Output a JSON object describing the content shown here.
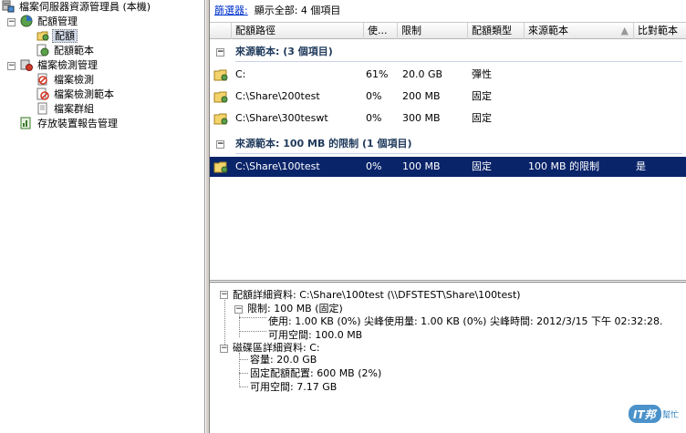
{
  "tree": {
    "root": "檔案伺服器資源管理員 (本機)",
    "quota_management": "配額管理",
    "quotas": "配額",
    "quota_templates": "配額範本",
    "file_screening": "檔案檢測管理",
    "file_screens": "檔案檢測",
    "file_screen_templates": "檔案檢測範本",
    "file_groups": "檔案群組",
    "storage_reports": "存放裝置報告管理"
  },
  "filterbar": {
    "filter_link": "篩選器:",
    "show_all": "顯示全部: 4 個項目"
  },
  "columns": {
    "path": "配額路徑",
    "usage": "使...",
    "limit": "限制",
    "type": "配額類型",
    "source_template": "來源範本",
    "matches": "比對範本"
  },
  "groups": [
    {
      "title": "來源範本: (3 個項目)",
      "rows": [
        {
          "path": "C:",
          "usage": "61%",
          "limit": "20.0 GB",
          "type": "彈性",
          "template": "",
          "match": ""
        },
        {
          "path": "C:\\Share\\200test",
          "usage": "0%",
          "limit": "200 MB",
          "type": "固定",
          "template": "",
          "match": ""
        },
        {
          "path": "C:\\Share\\300teswt",
          "usage": "0%",
          "limit": "300 MB",
          "type": "固定",
          "template": "",
          "match": ""
        }
      ]
    },
    {
      "title": "來源範本: 100 MB 的限制 (1 個項目)",
      "rows": [
        {
          "path": "C:\\Share\\100test",
          "usage": "0%",
          "limit": "100 MB",
          "type": "固定",
          "template": "100 MB 的限制",
          "match": "是"
        }
      ]
    }
  ],
  "details": {
    "quota_details": "配額詳細資料: C:\\Share\\100test (\\\\DFSTEST\\Share\\100test)",
    "limit": "限制: 100 MB (固定)",
    "usage": "使用: 1.00 KB (0%) 尖峰使用量: 1.00 KB (0%) 尖峰時間: 2012/3/15 下午 02:32:28.",
    "available": "可用空間: 100.0 MB",
    "volume_details": "磁碟區詳細資料: C:",
    "capacity": "容量: 20.0 GB",
    "fixed_quota": "固定配額配置: 600 MB (2%)",
    "volume_available": "可用空間: 7.17 GB"
  },
  "watermark": {
    "text": "IT邦",
    "subtext": "幫忙"
  }
}
